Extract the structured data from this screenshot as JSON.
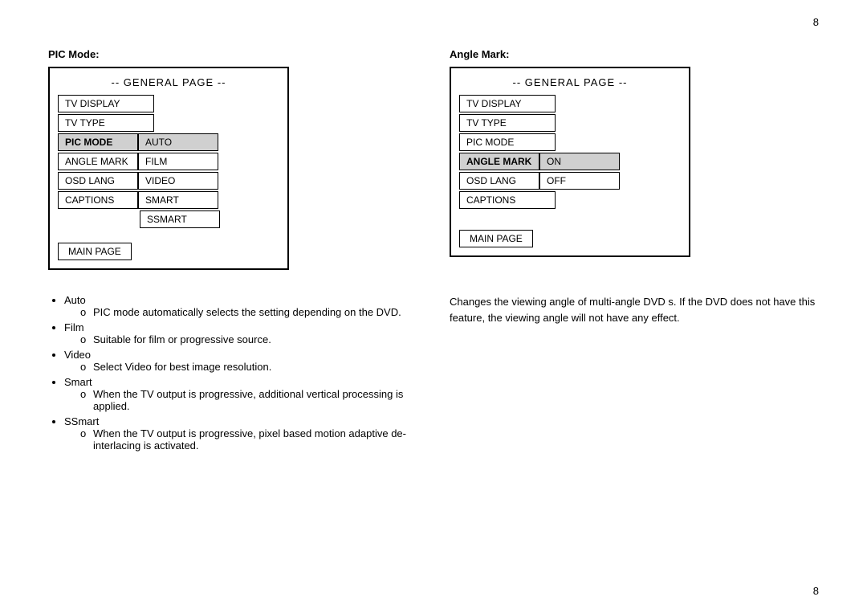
{
  "page": {
    "number": "8",
    "left_label": "PIC Mode:",
    "right_label": "Angle Mark:",
    "left_menu": {
      "title": "-- GENERAL PAGE --",
      "rows": [
        {
          "label": "TV DISPLAY",
          "value": null,
          "highlighted": false
        },
        {
          "label": "TV TYPE",
          "value": null,
          "highlighted": false
        },
        {
          "label": "PIC MODE",
          "value": "AUTO",
          "highlighted": true
        },
        {
          "label": "ANGLE MARK",
          "value": "FILM",
          "highlighted": false
        },
        {
          "label": "OSD LANG",
          "value": "VIDEO",
          "highlighted": false
        },
        {
          "label": "CAPTIONS",
          "value": "SMART",
          "highlighted": false
        }
      ],
      "extra_value": "SSMART",
      "main_page_btn": "MAIN PAGE"
    },
    "right_menu": {
      "title": "-- GENERAL PAGE --",
      "rows": [
        {
          "label": "TV DISPLAY",
          "value": null,
          "highlighted": false
        },
        {
          "label": "TV TYPE",
          "value": null,
          "highlighted": false
        },
        {
          "label": "PIC MODE",
          "value": null,
          "highlighted": false
        },
        {
          "label": "ANGLE MARK",
          "value": "ON",
          "highlighted": true
        },
        {
          "label": "OSD LANG",
          "value": "OFF",
          "highlighted": false
        },
        {
          "label": "CAPTIONS",
          "value": null,
          "highlighted": false
        }
      ],
      "main_page_btn": "MAIN PAGE"
    },
    "bullets": [
      {
        "label": "Auto",
        "subs": [
          "PIC mode automatically selects the setting depending on the DVD."
        ]
      },
      {
        "label": "Film",
        "subs": [
          "Suitable for film or progressive source."
        ]
      },
      {
        "label": "Video",
        "subs": [
          "Select Video for best image resolution."
        ]
      },
      {
        "label": "Smart",
        "subs": [
          "When the TV output is progressive, additional vertical processing is applied."
        ]
      },
      {
        "label": "SSmart",
        "subs": [
          "When the TV output is progressive, pixel based motion adaptive de-interlacing is activated."
        ]
      }
    ],
    "right_description": "Changes the viewing angle of multi-angle DVD s.  If the DVD does not have this feature, the viewing angle will not have any effect."
  }
}
